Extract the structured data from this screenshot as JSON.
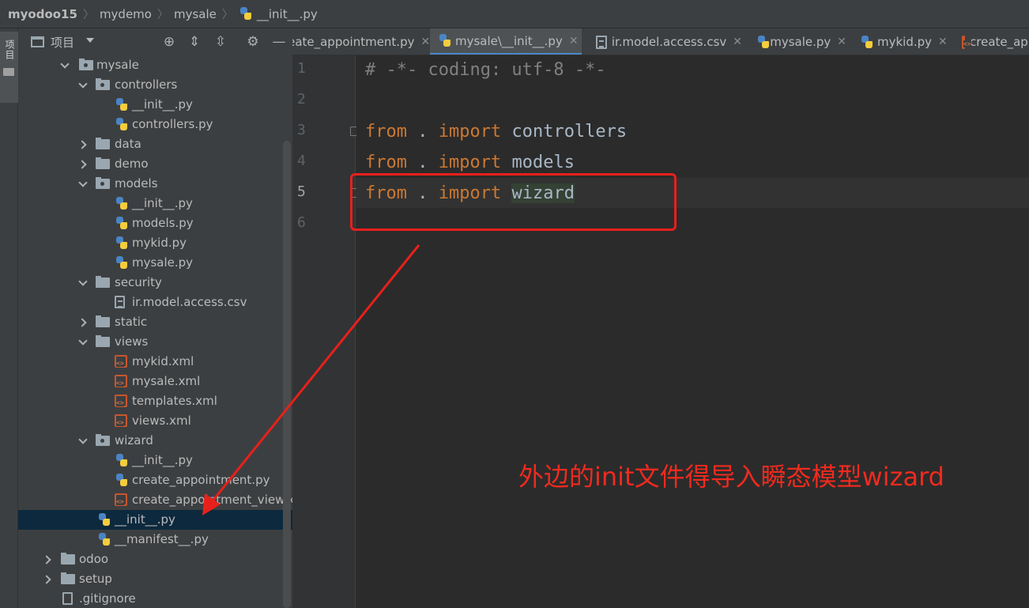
{
  "breadcrumb": [
    "myodoo15",
    "mydemo",
    "mysale",
    "__init__.py"
  ],
  "tool_strip": {
    "project_label": "项目"
  },
  "project_panel": {
    "title": "项目",
    "tree": [
      {
        "label": "mysale",
        "type": "package",
        "expanded": true,
        "depth": 1
      },
      {
        "label": "controllers",
        "type": "package",
        "expanded": true,
        "depth": 2
      },
      {
        "label": "__init__.py",
        "type": "python",
        "depth": 3
      },
      {
        "label": "controllers.py",
        "type": "python",
        "depth": 3
      },
      {
        "label": "data",
        "type": "folder",
        "expanded": false,
        "depth": 2
      },
      {
        "label": "demo",
        "type": "folder",
        "expanded": false,
        "depth": 2
      },
      {
        "label": "models",
        "type": "package",
        "expanded": true,
        "depth": 2
      },
      {
        "label": "__init__.py",
        "type": "python",
        "depth": 3
      },
      {
        "label": "models.py",
        "type": "python",
        "depth": 3
      },
      {
        "label": "mykid.py",
        "type": "python",
        "depth": 3
      },
      {
        "label": "mysale.py",
        "type": "python",
        "depth": 3
      },
      {
        "label": "security",
        "type": "folder",
        "expanded": true,
        "depth": 2
      },
      {
        "label": "ir.model.access.csv",
        "type": "csv",
        "depth": 3
      },
      {
        "label": "static",
        "type": "folder",
        "expanded": false,
        "depth": 2
      },
      {
        "label": "views",
        "type": "folder",
        "expanded": true,
        "depth": 2
      },
      {
        "label": "mykid.xml",
        "type": "xml",
        "depth": 3
      },
      {
        "label": "mysale.xml",
        "type": "xml",
        "depth": 3
      },
      {
        "label": "templates.xml",
        "type": "xml",
        "depth": 3
      },
      {
        "label": "views.xml",
        "type": "xml",
        "depth": 3
      },
      {
        "label": "wizard",
        "type": "package",
        "expanded": true,
        "depth": 2
      },
      {
        "label": "__init__.py",
        "type": "python",
        "depth": 3
      },
      {
        "label": "create_appointment.py",
        "type": "python",
        "depth": 3
      },
      {
        "label": "create_appointment_view.xml",
        "type": "xml",
        "depth": 3
      },
      {
        "label": "__init__.py",
        "type": "python",
        "depth": 2,
        "selected": true
      },
      {
        "label": "__manifest__.py",
        "type": "python",
        "depth": 2
      },
      {
        "label": "odoo",
        "type": "folder",
        "expanded": false,
        "depth": 0
      },
      {
        "label": "setup",
        "type": "folder",
        "expanded": false,
        "depth": 0
      },
      {
        "label": ".gitignore",
        "type": "git",
        "depth": 1
      }
    ]
  },
  "tabs": [
    {
      "label": "create_appointment.py",
      "icon": "python",
      "active": false
    },
    {
      "label": "mysale\\__init__.py",
      "icon": "python",
      "active": true
    },
    {
      "label": "ir.model.access.csv",
      "icon": "csv",
      "active": false
    },
    {
      "label": "mysale.py",
      "icon": "python",
      "active": false
    },
    {
      "label": "mykid.py",
      "icon": "python",
      "active": false
    },
    {
      "label": "create_appointment_view.xml",
      "icon": "xml",
      "active": false
    }
  ],
  "editor": {
    "current_line": 5,
    "lines": [
      {
        "n": "1",
        "parts": [
          [
            "cm",
            "# -*- coding: utf-8 -*-"
          ]
        ]
      },
      {
        "n": "2",
        "parts": []
      },
      {
        "n": "3",
        "parts": [
          [
            "kw",
            "from"
          ],
          [
            "",
            " . "
          ],
          [
            "kw",
            "import"
          ],
          [
            "",
            " controllers"
          ]
        ]
      },
      {
        "n": "4",
        "parts": [
          [
            "kw",
            "from"
          ],
          [
            "",
            " . "
          ],
          [
            "kw",
            "import"
          ],
          [
            "",
            " models"
          ]
        ]
      },
      {
        "n": "5",
        "parts": [
          [
            "kw",
            "from"
          ],
          [
            "",
            " . "
          ],
          [
            "kw",
            "import"
          ],
          [
            "",
            " "
          ],
          [
            "hl",
            "wizard"
          ]
        ]
      },
      {
        "n": "6",
        "parts": []
      }
    ]
  },
  "annotation": {
    "text": "外边的init文件得导入瞬态模型wizard",
    "color": "#f02a1e"
  },
  "colors": {
    "keyword": "#cc7832",
    "comment": "#808080",
    "identifier": "#a9b7c6",
    "selection": "#0d293e",
    "annotation_red": "#e8201b"
  }
}
